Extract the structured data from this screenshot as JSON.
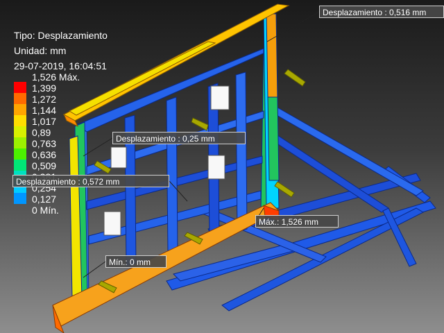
{
  "legend": {
    "type_line": "Tipo: Desplazamiento",
    "unit_line": "Unidad: mm",
    "date_line": "29-07-2019, 16:04:51"
  },
  "colorbar": {
    "labels": [
      "1,526 Máx.",
      "1,399",
      "1,272",
      "1,144",
      "1,017",
      "0,89",
      "0,763",
      "0,636",
      "0,509",
      "0,381",
      "0,254",
      "0,127",
      "0 Mín."
    ],
    "colors": [
      "#ff0000",
      "#ff6a00",
      "#ffa500",
      "#ffdd00",
      "#d8f000",
      "#9cf000",
      "#4cf000",
      "#00e676",
      "#00e0c0",
      "#00ccff",
      "#0096ff",
      "#0050ff",
      "#0010ff"
    ]
  },
  "probes": [
    {
      "label": "Desplazamiento : 0,516 mm"
    },
    {
      "label": "Desplazamiento : 0,25 mm"
    },
    {
      "label": "Desplazamiento : 0,572 mm"
    },
    {
      "label": "Máx.: 1,526 mm"
    },
    {
      "label": "Mín.: 0 mm"
    }
  ]
}
